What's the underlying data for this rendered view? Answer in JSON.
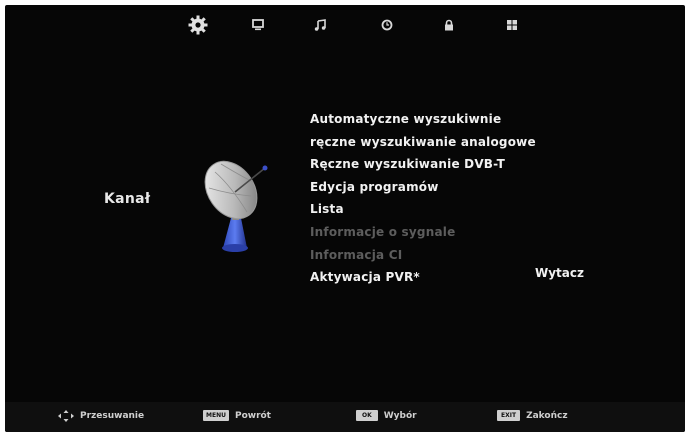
{
  "tabs": [
    {
      "icon": "gear-icon",
      "active": true
    },
    {
      "icon": "monitor-icon",
      "active": false
    },
    {
      "icon": "music-note-icon",
      "active": false
    },
    {
      "icon": "clock-icon",
      "active": false
    },
    {
      "icon": "lock-icon",
      "active": false
    },
    {
      "icon": "grid-icon",
      "active": false
    }
  ],
  "section": {
    "title": "Kanał",
    "icon": "satellite-dish-icon"
  },
  "menu": {
    "items": [
      {
        "label": "Automatyczne wyszukiwnie",
        "enabled": true
      },
      {
        "label": "ręczne wyszukiwanie analogowe",
        "enabled": true
      },
      {
        "label": "Ręczne wyszukiwanie DVB-T",
        "enabled": true
      },
      {
        "label": "Edycja programów",
        "enabled": true
      },
      {
        "label": "Lista",
        "enabled": true
      },
      {
        "label": "Informacje o sygnale",
        "enabled": false
      },
      {
        "label": "Informacja CI",
        "enabled": false
      },
      {
        "label": "Aktywacja PVR*",
        "enabled": true
      }
    ],
    "pvr_value": "Wytacz"
  },
  "footer": {
    "move_label": "Przesuwanie",
    "menu_key": "MENU",
    "back_label": "Powrót",
    "ok_key": "OK",
    "select_label": "Wybór",
    "exit_key": "EXIT",
    "exit_label": "Zakończ"
  },
  "colors": {
    "background": "#060606",
    "text": "#f2f2f2",
    "disabled_text": "#5d5d5d"
  }
}
